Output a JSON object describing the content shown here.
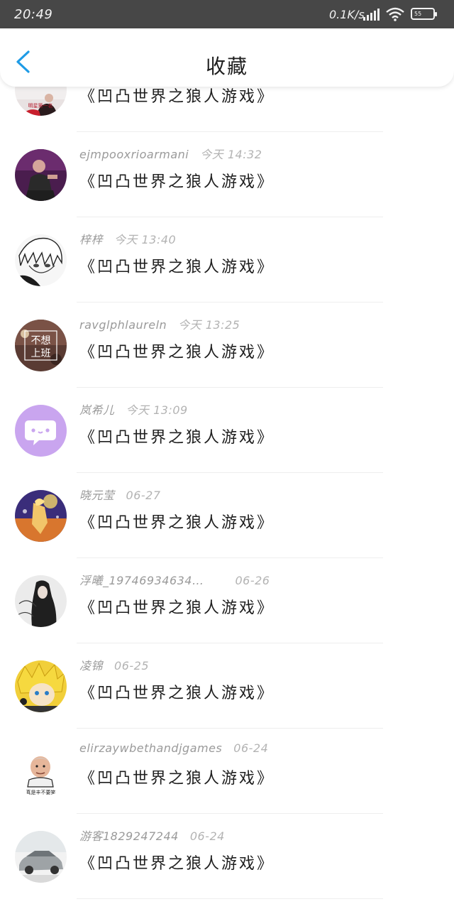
{
  "status_bar": {
    "time": "20:49",
    "network_speed": "0.1K/s",
    "battery": "55"
  },
  "header": {
    "title": "收藏"
  },
  "items": [
    {
      "user": "",
      "time": "",
      "message": "《凹凸世界之狼人游戏》",
      "avatar_text": "明星第一名"
    },
    {
      "user": "ejmpooxrioarmani",
      "time": "今天 14:32",
      "message": "《凹凸世界之狼人游戏》"
    },
    {
      "user": "梓梓",
      "time": "今天 13:40",
      "message": "《凹凸世界之狼人游戏》"
    },
    {
      "user": "ravglphlaureln",
      "time": "今天 13:25",
      "message": "《凹凸世界之狼人游戏》",
      "avatar_text": [
        "不想",
        "上班"
      ]
    },
    {
      "user": "岚希儿",
      "time": "今天 13:09",
      "message": "《凹凸世界之狼人游戏》"
    },
    {
      "user": "晓元莹",
      "time": "06-27",
      "message": "《凹凸世界之狼人游戏》"
    },
    {
      "user": "浮曦_19746934634…",
      "time": "06-26",
      "message": "《凹凸世界之狼人游戏》"
    },
    {
      "user": "凌锦",
      "time": "06-25",
      "message": "《凹凸世界之狼人游戏》"
    },
    {
      "user": "elirzaywbethandjgames",
      "time": "06-24",
      "message": "《凹凸世界之狼人游戏》",
      "avatar_text": "真是丰不要笑"
    },
    {
      "user": "游客1829247244",
      "time": "06-24",
      "message": "《凹凸世界之狼人游戏》"
    }
  ],
  "colors": {
    "accent": "#1e9be6",
    "statusbar": "#474747",
    "lilac": "#c9a5ef"
  }
}
